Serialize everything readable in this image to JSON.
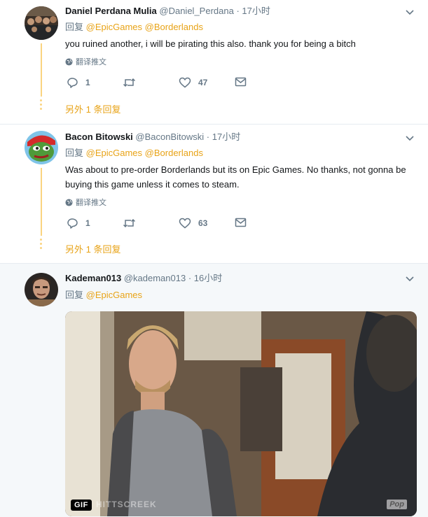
{
  "tweets": [
    {
      "name": "Daniel Perdana Mulia",
      "handle": "@Daniel_Perdana",
      "time": "· 17小时",
      "reply_prefix": "回复",
      "mentions": [
        "@EpicGames",
        "@Borderlands"
      ],
      "text": "you ruined another, i will be pirating this also. thank you for being a bitch",
      "translate": "翻译推文",
      "replies": "1",
      "likes": "47",
      "more_replies": "另外 1 条回复"
    },
    {
      "name": "Bacon Bitowski",
      "handle": "@BaconBitowski",
      "time": "· 17小时",
      "reply_prefix": "回复",
      "mentions": [
        "@EpicGames",
        "@Borderlands"
      ],
      "text": "Was about to pre-order Borderlands but its on Epic Games. No thanks, not gonna be buying this game unless it comes to steam.",
      "translate": "翻译推文",
      "replies": "1",
      "likes": "63",
      "more_replies": "另外 1 条回复"
    },
    {
      "name": "Kademan013",
      "handle": "@kademan013",
      "time": "· 16小时",
      "reply_prefix": "回复",
      "mentions": [
        "@EpicGames"
      ],
      "media": {
        "badge": "GIF",
        "watermark": "HITTSCREEK",
        "brand": "Pop"
      }
    }
  ],
  "colors": {
    "accent": "#e8a317",
    "thread": "#fad480",
    "muted": "#657786"
  }
}
